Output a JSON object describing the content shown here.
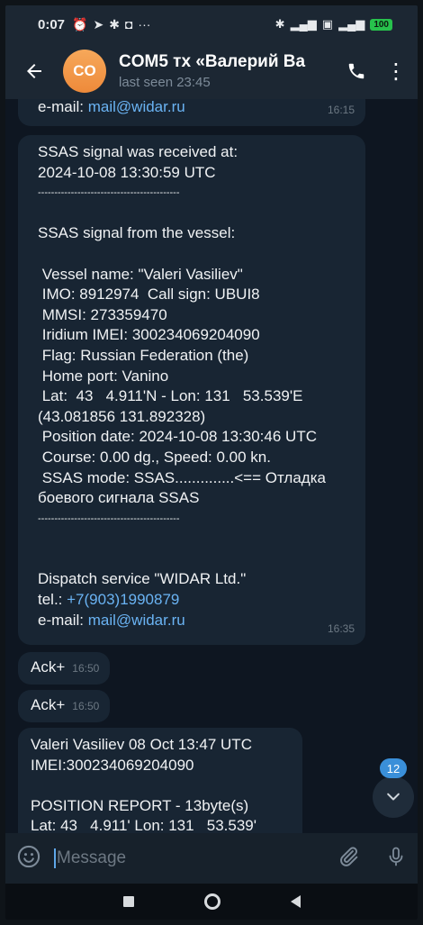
{
  "status_bar": {
    "time": "0:07",
    "left_icons": [
      "alarm-icon",
      "telegram-icon",
      "settings-icon",
      "screen-icon",
      "more-icon"
    ],
    "right_icons": [
      "bluetooth-icon",
      "signal-icon",
      "sim-icon",
      "wifi-signal-icon"
    ],
    "battery": "100"
  },
  "header": {
    "avatar_initials": "CO",
    "title": "COM5 тх «Валерий Ва",
    "subtitle": "last seen 23:45"
  },
  "messages": {
    "top_partial": {
      "label": "e-mail: ",
      "link": "mail@widar.ru",
      "time": "16:15"
    },
    "main": {
      "lines": [
        "SSAS signal was received at:",
        "2024-10-08 13:30:59 UTC",
        "-------------------------------------------",
        "",
        "SSAS signal from the vessel:",
        "",
        " Vessel name: \"Valeri Vasiliev\"",
        " IMO: 8912974  Call sign: UBUI8",
        " MMSI: 273359470",
        " Iridium IMEI: 300234069204090",
        " Flag: Russian Federation (the)",
        " Home port: Vanino",
        " Lat:  43   4.911'N - Lon: 131   53.539'E",
        "(43.081856 131.892328)",
        " Position date: 2024-10-08 13:30:46 UTC",
        " Course: 0.00 dg., Speed: 0.00 kn.",
        " SSAS mode: SSAS..............<== Отладка",
        "боевого сигнала SSAS",
        "-------------------------------------------",
        "",
        "",
        "Dispatch service \"WIDAR Ltd.\""
      ],
      "tel_label": "tel.: ",
      "tel_link": "+7(903)1990879",
      "email_label": "e-mail: ",
      "email_link": "mail@widar.ru",
      "time": "16:35"
    },
    "ack1": {
      "text": "Ack+",
      "time": "16:50"
    },
    "ack2": {
      "text": "Ack+",
      "time": "16:50"
    },
    "last": {
      "lines": [
        "Valeri Vasiliev 08 Oct 13:47 UTC",
        "IMEI:300234069204090",
        "",
        "POSITION REPORT - 13byte(s)",
        "Lat: 43   4.911' Lon: 131   53.539'"
      ]
    }
  },
  "scroll_badge": "12",
  "input": {
    "placeholder": "Message",
    "icons": [
      "emoji-icon",
      "attach-icon",
      "mic-icon"
    ]
  },
  "colors": {
    "header_bg": "#1c2733",
    "chat_bg": "#0e1621",
    "bubble_bg": "#182533",
    "link": "#6ab3f3",
    "avatar": "#f09a4c",
    "badge": "#3a8fd9"
  }
}
